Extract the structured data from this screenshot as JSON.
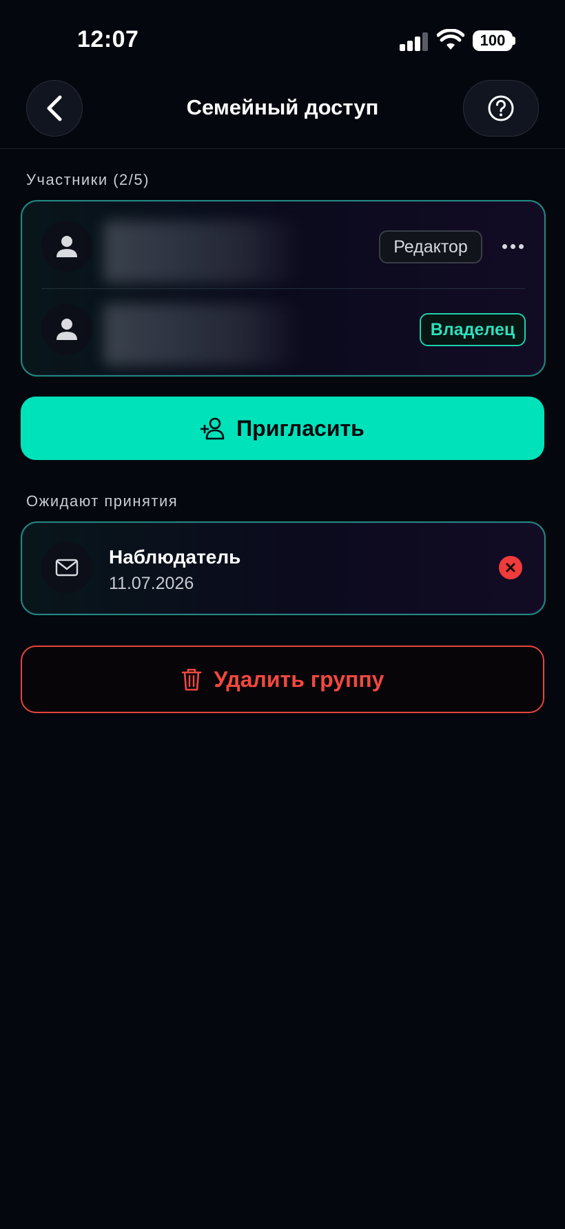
{
  "status_bar": {
    "time": "12:07",
    "battery": "100"
  },
  "header": {
    "title": "Семейный доступ",
    "back_icon": "chevron-left-icon",
    "help_icon": "question-circle-icon"
  },
  "members": {
    "label": "Участники (2/5)",
    "items": [
      {
        "role": "Редактор",
        "name_hidden": true
      },
      {
        "role": "Владелец",
        "name_hidden": true
      }
    ]
  },
  "invite": {
    "label": "Пригласить",
    "icon": "person-add-icon"
  },
  "pending": {
    "label": "Ожидают принятия",
    "items": [
      {
        "role": "Наблюдатель",
        "date": "11.07.2026",
        "icon": "mail-icon"
      }
    ]
  },
  "delete_group": {
    "label": "Удалить группу",
    "icon": "trash-icon"
  },
  "colors": {
    "accent": "#00e2b9",
    "danger": "#f2483f",
    "background": "#05070e"
  }
}
